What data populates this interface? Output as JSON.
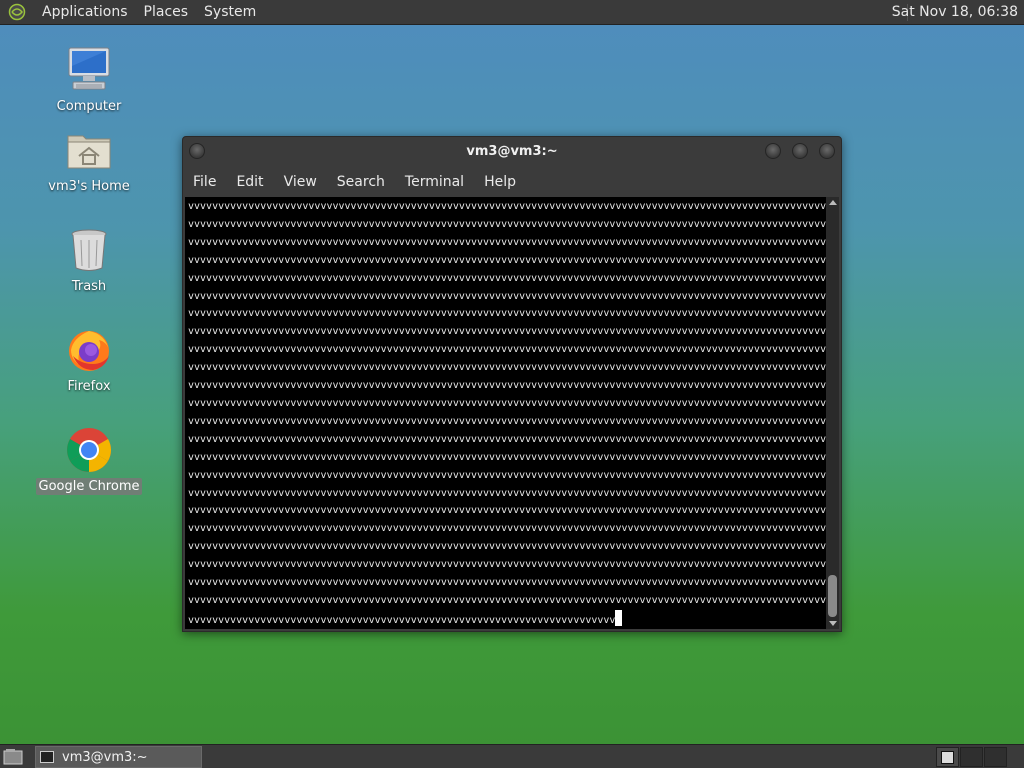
{
  "top_panel": {
    "menus": [
      "Applications",
      "Places",
      "System"
    ],
    "clock": "Sat Nov 18, 06:38"
  },
  "desktop_icons": [
    {
      "label": "Computer",
      "icon": "computer-icon"
    },
    {
      "label": "vm3's Home",
      "icon": "home-folder-icon"
    },
    {
      "label": "Trash",
      "icon": "trash-icon"
    },
    {
      "label": "Firefox",
      "icon": "firefox-icon"
    },
    {
      "label": "Google Chrome",
      "icon": "chrome-icon",
      "selected": true
    }
  ],
  "terminal": {
    "title": "vm3@vm3:~",
    "menu": [
      "File",
      "Edit",
      "View",
      "Search",
      "Terminal",
      "Help"
    ],
    "full_line": "vvvvvvvvvvvvvvvvvvvvvvvvvvvvvvvvvvvvvvvvvvvvvvvvvvvvvvvvvvvvvvvvvvvvvvvvvvvvvvvvvvvvvvvvvvvvvvvvvvvvvvvvvvvvvvvvvvvvvvvvvvvvvv",
    "full_line_count": 23,
    "last_line": "vvvvvvvvvvvvvvvvvvvvvvvvvvvvvvvvvvvvvvvvvvvvvvvvvvvvvvvvvvvvvvvvvvvvvvv"
  },
  "taskbar": {
    "tasks": [
      {
        "label": "vm3@vm3:~",
        "icon": "terminal-icon"
      }
    ]
  },
  "colors": {
    "panel": "#3a3a3a",
    "terminal_bg": "#000000",
    "terminal_fg": "#e8e8e8"
  }
}
